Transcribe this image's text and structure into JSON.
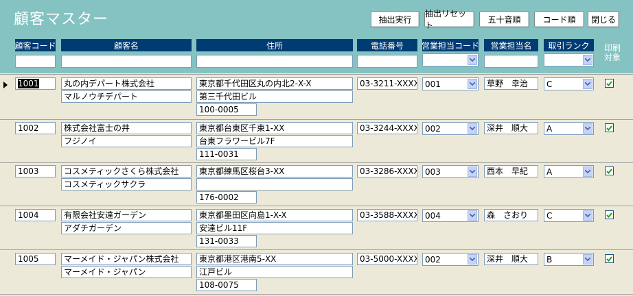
{
  "header": {
    "title": "顧客マスター",
    "buttons": {
      "extract": "抽出実行",
      "reset": "抽出リセット",
      "kana_order": "五十音順",
      "code_order": "コード順",
      "close": "閉じる"
    }
  },
  "columns": {
    "code": "顧客コード",
    "name": "顧客名",
    "address": "住所",
    "phone": "電話番号",
    "sales_code": "営業担当コード",
    "sales_name": "営業担当名",
    "rank": "取引ランク",
    "print_line1": "印刷",
    "print_line2": "対象"
  },
  "filters": {
    "code": "",
    "name": "",
    "address": "",
    "phone": "",
    "sales_code": "",
    "sales_name": "",
    "rank": ""
  },
  "records": [
    {
      "code": "1001",
      "name": "丸の内デパート株式会社",
      "kana": "マルノウチデパート",
      "address1": "東京都千代田区丸の内北2-X-X",
      "address2": "第三千代田ビル",
      "zip": "100-0005",
      "phone": "03-3211-XXXX",
      "sales_code": "001",
      "sales_name": "草野　幸治",
      "rank": "C",
      "print": true
    },
    {
      "code": "1002",
      "name": "株式会社富士の井",
      "kana": "フジノイ",
      "address1": "東京都台東区千束1-XX",
      "address2": "台東フラワービル7F",
      "zip": "111-0031",
      "phone": "03-3244-XXXX",
      "sales_code": "002",
      "sales_name": "深井　順大",
      "rank": "A",
      "print": true
    },
    {
      "code": "1003",
      "name": "コスメティックさくら株式会社",
      "kana": "コスメティックサクラ",
      "address1": "東京都練馬区桜台3-XX",
      "address2": "",
      "zip": "176-0002",
      "phone": "03-3286-XXXX",
      "sales_code": "003",
      "sales_name": "西本　早紀",
      "rank": "A",
      "print": true
    },
    {
      "code": "1004",
      "name": "有限会社安達ガーデン",
      "kana": "アダチガーデン",
      "address1": "東京都墨田区向島1-X-X",
      "address2": "安達ビル11F",
      "zip": "131-0033",
      "phone": "03-3588-XXXX",
      "sales_code": "004",
      "sales_name": "森　さおり",
      "rank": "C",
      "print": true
    },
    {
      "code": "1005",
      "name": "マーメイド・ジャパン株式会社",
      "kana": "マーメイド・ジャパン",
      "address1": "東京都港区港南5-XX",
      "address2": "江戸ビル",
      "zip": "108-0075",
      "phone": "03-5000-XXXX",
      "sales_code": "002",
      "sales_name": "深井　順大",
      "rank": "B",
      "print": true
    }
  ],
  "colors": {
    "header_bg": "#85c2c2",
    "column_header_bg": "#003c74",
    "form_bg": "#ece9d8",
    "dropdown_button": "#c3d3fd",
    "checkbox_check": "#21a121"
  }
}
